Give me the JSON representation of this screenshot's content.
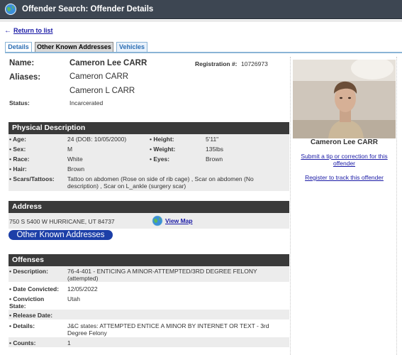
{
  "window": {
    "title": "Offender Search: Offender Details"
  },
  "nav": {
    "return_label": "Return to list"
  },
  "tabs": [
    "Details",
    "Other Known Addresses",
    "Vehicles"
  ],
  "profile": {
    "name_label": "Name:",
    "name": "Cameron Lee CARR",
    "registration_label": "Registration #:",
    "registration": "10726973",
    "aliases_label": "Aliases:",
    "aliases": [
      "Cameron CARR",
      "Cameron L CARR"
    ],
    "status_label": "Status:",
    "status": "Incarcerated"
  },
  "physical": {
    "heading": "Physical Description",
    "age_label": "• Age:",
    "age": "24  (DOB: 10/05/2000)",
    "height_label": "• Height:",
    "height": "5'11\"",
    "sex_label": "• Sex:",
    "sex": "M",
    "weight_label": "• Weight:",
    "weight": "135lbs",
    "race_label": "• Race:",
    "race": "White",
    "eyes_label": "• Eyes:",
    "eyes": "Brown",
    "hair_label": "• Hair:",
    "hair": "Brown",
    "scars_label": "• Scars/Tattoos:",
    "scars": "Tattoo on abdomen (Rose on side of rib cage) , Scar on abdomen (No description) , Scar on L_ankle (surgery scar)"
  },
  "address": {
    "heading": "Address",
    "line": "750 S 5400 W HURRICANE, UT 84737",
    "view_map": "View Map",
    "other_button": "Other Known Addresses"
  },
  "offenses": {
    "heading": "Offenses",
    "description_label": "• Description:",
    "description": "76-4-401 - ENTICING A MINOR-ATTEMPTED/3RD DEGREE FELONY (attempted)",
    "date_label": "• Date Convicted:",
    "date": "12/05/2022",
    "state_label": "• Conviction State:",
    "state": "Utah",
    "release_label": "• Release Date:",
    "release": "",
    "details_label": "• Details:",
    "details": "J&C states: ATTEMPTED ENTICE A MINOR BY INTERNET OR TEXT - 3rd Degree Felony",
    "counts_label": "• Counts:",
    "counts": "1"
  },
  "sidebar": {
    "photo_name": "Cameron Lee CARR",
    "tip_link": "Submit a tip or correction for this offender",
    "track_link": "Register to track this offender"
  }
}
